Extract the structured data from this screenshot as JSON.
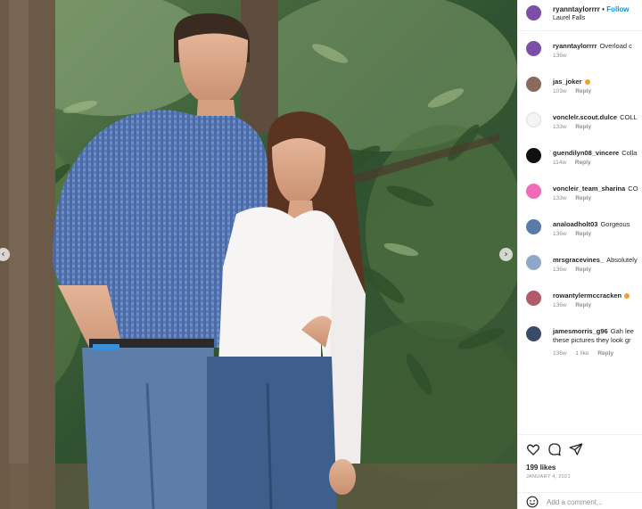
{
  "post": {
    "username": "ryanntaylorrrr",
    "dot": "•",
    "follow_label": "Follow",
    "location": "Laurel Falls"
  },
  "comments": [
    {
      "user": "ryanntaylorrrr",
      "text": "Overload c",
      "time": "136w",
      "likes": "",
      "reply": "",
      "avatar_color": "#7b4ea8"
    },
    {
      "user": "jas_joker",
      "text": "",
      "time": "103w",
      "likes": "",
      "reply": "Reply",
      "avatar_color": "#8a6a5a",
      "badge": true
    },
    {
      "user": "vonclelr.scout.dulce",
      "text": "COLL",
      "time": "133w",
      "likes": "",
      "reply": "Reply",
      "avatar_color": "#f4f4f4"
    },
    {
      "user": "guendilyn08_vincere",
      "text": "Colla",
      "time": "114w",
      "likes": "",
      "reply": "Reply",
      "avatar_color": "#111111"
    },
    {
      "user": "voncleir_team_sharina",
      "text": "CO",
      "time": "133w",
      "likes": "",
      "reply": "Reply",
      "avatar_color": "#f06ab8"
    },
    {
      "user": "analoadholt03",
      "text": "Gorgeous",
      "time": "136w",
      "likes": "",
      "reply": "Reply",
      "avatar_color": "#5a7aa8"
    },
    {
      "user": "mrsgracevines_",
      "text": "Absolutely",
      "time": "136w",
      "likes": "",
      "reply": "Reply",
      "avatar_color": "#8fa8c8"
    },
    {
      "user": "rowantylermccracken",
      "text": "",
      "time": "136w",
      "likes": "",
      "reply": "Reply",
      "avatar_color": "#b05a6a",
      "badge": true
    },
    {
      "user": "jamesmorris_g96",
      "text": "Gah lee",
      "text2": "these pictures they look gr",
      "time": "136w",
      "likes": "1 like",
      "reply": "Reply",
      "avatar_color": "#3a4a6a"
    }
  ],
  "actions": {
    "likes": "199 likes",
    "date": "JANUARY 4, 2021",
    "comment_placeholder": "Add a comment..."
  },
  "icons": {
    "heart": "heart-icon",
    "comment": "comment-icon",
    "share": "share-icon",
    "emoji": "emoji-icon",
    "prev": "chevron-left-icon",
    "next": "chevron-right-icon"
  }
}
